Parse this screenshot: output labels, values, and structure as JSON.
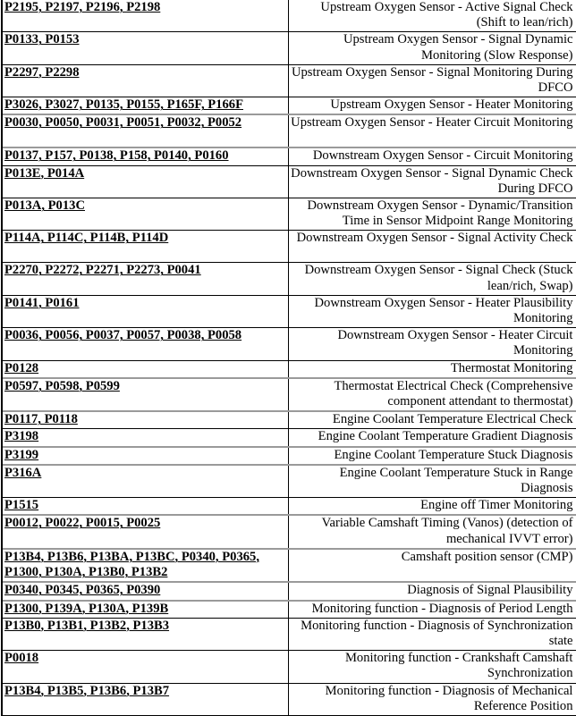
{
  "table": {
    "rows": [
      {
        "codes": "P2195, P2197, P2196, P2198",
        "description": "Upstream Oxygen Sensor - Active Signal Check (Shift to lean/rich)"
      },
      {
        "codes": "P0133, P0153",
        "description": "Upstream Oxygen Sensor - Signal Dynamic Monitoring (Slow Response)"
      },
      {
        "codes": "P2297, P2298",
        "description": "Upstream Oxygen Sensor - Signal Monitoring During DFCO"
      },
      {
        "codes": "P3026, P3027, P0135, P0155, P165F, P166F",
        "description": "Upstream Oxygen Sensor - Heater Monitoring"
      },
      {
        "codes": "P0030, P0050, P0031, P0051, P0032, P0052",
        "description": "Upstream Oxygen Sensor - Heater Circuit Monitoring"
      },
      {
        "codes": "P0137, P157, P0138, P158, P0140, P0160",
        "description": "Downstream Oxygen Sensor - Circuit Monitoring"
      },
      {
        "codes": "P013E, P014A",
        "description": "Downstream Oxygen Sensor - Signal Dynamic Check During DFCO"
      },
      {
        "codes": "P013A, P013C",
        "description": "Downstream Oxygen Sensor - Dynamic/Transition Time in Sensor Midpoint Range Monitoring"
      },
      {
        "codes": "P114A, P114C, P114B, P114D",
        "description": "Downstream Oxygen Sensor - Signal Activity Check"
      },
      {
        "codes": "P2270, P2272, P2271, P2273, P0041",
        "description": "Downstream Oxygen Sensor - Signal Check (Stuck lean/rich, Swap)"
      },
      {
        "codes": "P0141, P0161",
        "description": "Downstream Oxygen Sensor - Heater Plausibility Monitoring"
      },
      {
        "codes": "P0036, P0056, P0037, P0057, P0038, P0058",
        "description": "Downstream Oxygen Sensor - Heater Circuit Monitoring"
      },
      {
        "codes": "P0128",
        "description": "Thermostat Monitoring"
      },
      {
        "codes": "P0597, P0598, P0599",
        "description": "Thermostat Electrical Check (Comprehensive component attendant to thermostat)"
      },
      {
        "codes": "P0117, P0118",
        "description": "Engine Coolant Temperature Electrical Check"
      },
      {
        "codes": "P3198",
        "description": "Engine Coolant Temperature Gradient Diagnosis"
      },
      {
        "codes": "P3199",
        "description": "Engine Coolant Temperature Stuck Diagnosis"
      },
      {
        "codes": "P316A",
        "description": "Engine Coolant Temperature Stuck in Range Diagnosis"
      },
      {
        "codes": "P1515",
        "description": "Engine off Timer Monitoring"
      },
      {
        "codes": "P0012, P0022, P0015, P0025",
        "description": "Variable Camshaft Timing (Vanos) (detection of mechanical IVVT error)"
      },
      {
        "codes": "P13B4, P13B6, P13BA, P13BC, P0340, P0365, P1300, P130A, P13B0, P13B2",
        "description": "Camshaft position sensor (CMP)"
      },
      {
        "codes": "P0340, P0345, P0365, P0390",
        "description": "Diagnosis of Signal Plausibility"
      },
      {
        "codes": "P1300, P139A, P130A, P139B",
        "description": "Monitoring function - Diagnosis of Period Length"
      },
      {
        "codes": "P13B0, P13B1, P13B2, P13B3",
        "description": "Monitoring function - Diagnosis of Synchronization state"
      },
      {
        "codes": "P0018",
        "description": "Monitoring function - Crankshaft Camshaft Synchronization"
      },
      {
        "codes": "P13B4, P13B5, P13B6, P13B7",
        "description": "Monitoring function - Diagnosis of Mechanical Reference Position"
      }
    ]
  }
}
